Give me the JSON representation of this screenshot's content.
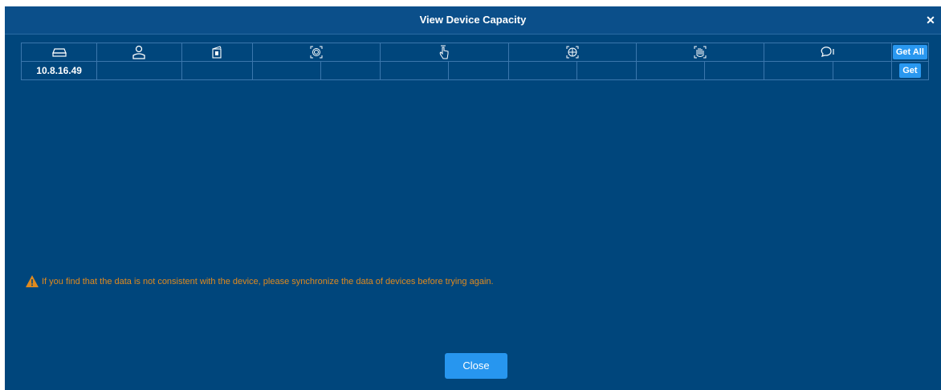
{
  "dialog": {
    "title": "View Device Capacity",
    "close_icon": "close-icon",
    "header_icons": [
      "device-icon",
      "person-icon",
      "card-icon",
      "fingerprint-icon",
      "finger-vein-icon",
      "face-icon",
      "palm-icon",
      "speech-icon"
    ],
    "get_all_label": "Get All",
    "rows": [
      {
        "ip": "10.8.16.49",
        "get_label": "Get"
      }
    ],
    "warning_icon": "warning-icon",
    "warning_text": "If you find that the data is not consistent with the device, please synchronize the data of devices before trying again.",
    "close_label": "Close",
    "colors": {
      "background": "#00467c",
      "button": "#2796ef",
      "warning": "#e08a1e"
    }
  }
}
